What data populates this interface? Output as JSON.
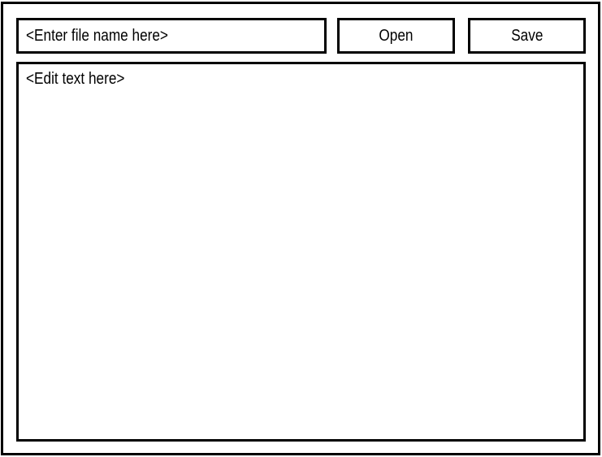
{
  "toolbar": {
    "filename_placeholder": "<Enter file name here>",
    "open_label": "Open",
    "save_label": "Save"
  },
  "editor": {
    "placeholder": "<Edit text here>"
  }
}
